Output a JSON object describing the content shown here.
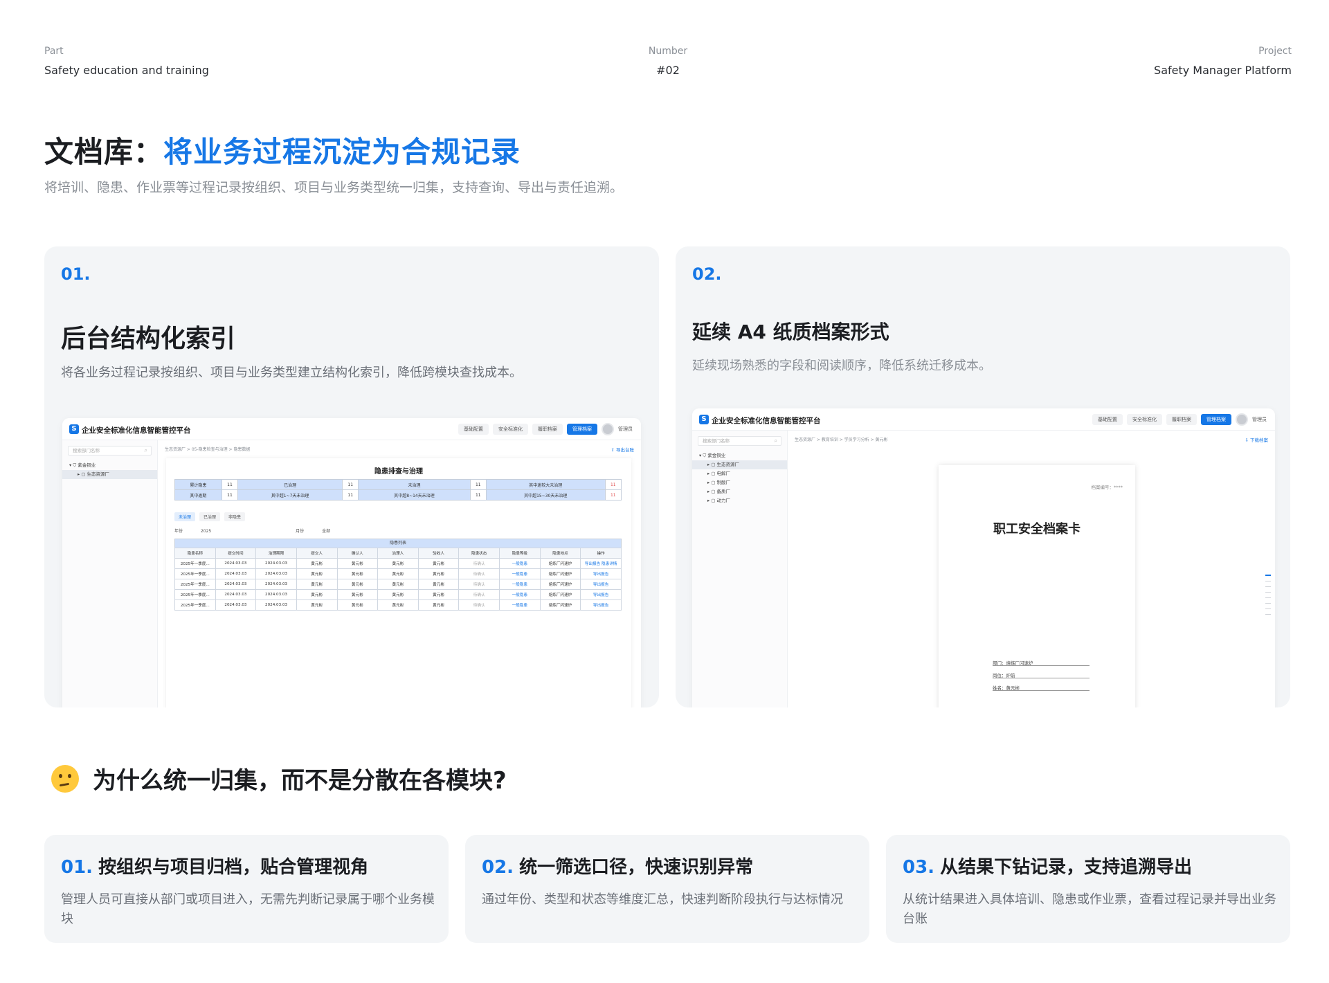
{
  "header": {
    "part_label": "Part",
    "part_value": "Safety education and training",
    "number_label": "Number",
    "number_value": "#02",
    "project_label": "Project",
    "project_value": "Safety Manager Platform"
  },
  "hero": {
    "title_prefix": "文档库：",
    "title_highlight": "将业务过程沉淀为合规记录",
    "subtitle": "将培训、隐患、作业票等过程记录按组织、项目与业务类型统一归集，支持查询、导出与责任追溯。"
  },
  "colors": {
    "accent": "#1677e6",
    "card_bg": "#f3f5f7",
    "header_cell": "#cfe0fb"
  },
  "cards": [
    {
      "num": "01.",
      "title": "后台结构化索引",
      "desc": "将各业务过程记录按组织、项目与业务类型建立结构化索引，降低跨模块查找成本。"
    },
    {
      "num": "02.",
      "title": "延续 A4 纸质档案形式",
      "desc": "延续现场熟悉的字段和阅读顺序，降低系统迁移成本。"
    }
  ],
  "app": {
    "logo": "S",
    "title": "企业安全标准化信息智能管控平台",
    "navs": [
      "基础配置",
      "安全标准化",
      "履职档案",
      "管理档案"
    ],
    "user": "管理员",
    "search_placeholder": "搜索部门名称"
  },
  "app1": {
    "tree": [
      "紫金铜业",
      "生态资源厂"
    ],
    "crumb": "生态资源厂  >  05-隐患检查与治理  >  隐患数据",
    "export": "⇪ 导出台账",
    "page_title": "隐患排查与治理",
    "summary": [
      [
        "累计隐患",
        "11",
        "已治理",
        "11",
        "未治理",
        "11",
        "其中逾较大未治理",
        "11"
      ],
      [
        "其中逾期",
        "11",
        "其中超1~7天未治理",
        "11",
        "其中超8~14天未治理",
        "11",
        "其中超15~30天未治理",
        "11"
      ]
    ],
    "tabs": [
      "未治理",
      "已治理",
      "非隐患"
    ],
    "filter": {
      "year_label": "年份",
      "year_value": "2025",
      "month_label": "月份",
      "month_value": "全部"
    },
    "list_caption": "隐患列表",
    "list_headers": [
      "隐患名称",
      "提交时间",
      "治理期限",
      "提交人",
      "确认人",
      "治理人",
      "验收人",
      "隐患状态",
      "隐患等级",
      "隐患地点",
      "操作"
    ],
    "rows": [
      [
        "2025年一季度...",
        "2024.03.03",
        "2024.03.03",
        "黄元彬",
        "黄元彬",
        "黄元彬",
        "黄元彬",
        "待确认",
        "一般隐患",
        "熔炼厂闪速炉",
        "导出报告 隐患详情"
      ],
      [
        "2025年一季度...",
        "2024.03.03",
        "2024.03.03",
        "黄元彬",
        "黄元彬",
        "黄元彬",
        "黄元彬",
        "待确认",
        "一般隐患",
        "熔炼厂闪速炉",
        "导出报告"
      ],
      [
        "2025年一季度...",
        "2024.03.03",
        "2024.03.03",
        "黄元彬",
        "黄元彬",
        "黄元彬",
        "黄元彬",
        "待确认",
        "一般隐患",
        "熔炼厂闪速炉",
        "导出报告"
      ],
      [
        "2025年一季度...",
        "2024.03.03",
        "2024.03.03",
        "黄元彬",
        "黄元彬",
        "黄元彬",
        "黄元彬",
        "待确认",
        "一般隐患",
        "熔炼厂闪速炉",
        "导出报告"
      ],
      [
        "2025年一季度...",
        "2024.03.03",
        "2024.03.03",
        "黄元彬",
        "黄元彬",
        "黄元彬",
        "黄元彬",
        "待确认",
        "一般隐患",
        "熔炼厂闪速炉",
        "导出报告"
      ]
    ]
  },
  "app2": {
    "tree": [
      "紫金铜业",
      "生态资源厂",
      "电解厂",
      "制酸厂",
      "备质厂",
      "动力厂"
    ],
    "crumb": "生态资源厂  >  教育培训  >  学员学习分析  >  黄元彬",
    "export": "⇩ 下载档案",
    "doc_no": "档案编号：****",
    "doc_title": "职工安全档案卡",
    "fields": [
      "部门：熔炼厂闪速炉",
      "岗位：炉前",
      "姓名：黄元彬"
    ]
  },
  "why": {
    "title": "为什么统一归集，而不是分散在各模块?"
  },
  "features": [
    {
      "num": "01.",
      "title": "按组织与项目归档，贴合管理视角",
      "desc": "管理人员可直接从部门或项目进入，无需先判断记录属于哪个业务模块"
    },
    {
      "num": "02.",
      "title": "统一筛选口径，快速识别异常",
      "desc": "通过年份、类型和状态等维度汇总，快速判断阶段执行与达标情况"
    },
    {
      "num": "03.",
      "title": "从结果下钻记录，支持追溯导出",
      "desc": "从统计结果进入具体培训、隐患或作业票，查看过程记录并导出业务台账"
    }
  ]
}
